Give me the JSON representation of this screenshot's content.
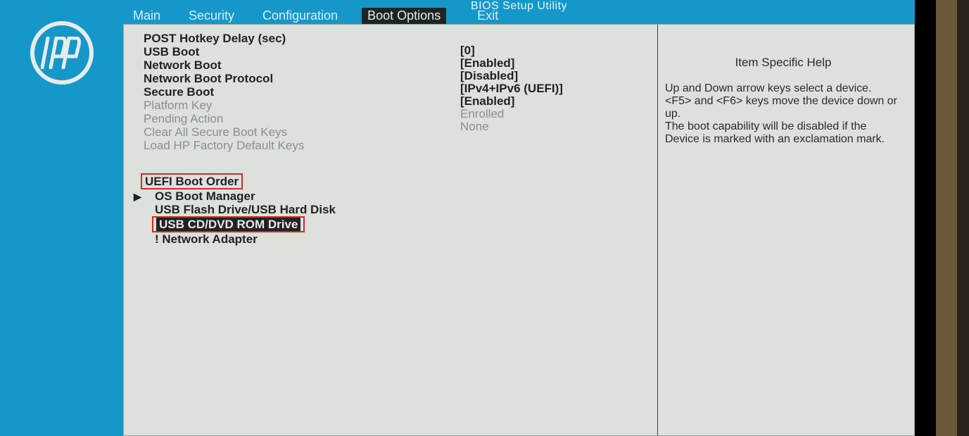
{
  "app_title": "BIOS Setup Utility",
  "tabs": {
    "main": "Main",
    "security": "Security",
    "configuration": "Configuration",
    "boot_options": "Boot Options",
    "exit": "Exit"
  },
  "options": {
    "post_delay": "POST Hotkey Delay (sec)",
    "usb_boot": "USB Boot",
    "network_boot": "Network Boot",
    "network_proto": "Network Boot Protocol",
    "secure_boot": "Secure Boot",
    "platform_key": "Platform Key",
    "pending_action": "Pending Action",
    "clear_keys": "Clear All Secure Boot Keys",
    "load_defaults": "Load HP Factory Default Keys"
  },
  "values": {
    "post_delay": "[0]",
    "usb_boot": "[Enabled]",
    "network_boot": "[Disabled]",
    "network_proto": "[IPv4+IPv6 (UEFI)]",
    "secure_boot": "[Enabled]",
    "platform_key": "Enrolled",
    "pending_action": "None"
  },
  "boot_order": {
    "heading": "UEFI Boot Order",
    "items": [
      "OS Boot Manager",
      "USB Flash Drive/USB Hard Disk",
      "USB CD/DVD ROM Drive",
      "! Network Adapter"
    ]
  },
  "help": {
    "title": "Item Specific Help",
    "body1": "Up and Down arrow keys select a device.",
    "body2": "<F5> and <F6> keys move the device down or up.",
    "body3": "The boot capability will be disabled if the Device is marked with an exclamation mark."
  }
}
